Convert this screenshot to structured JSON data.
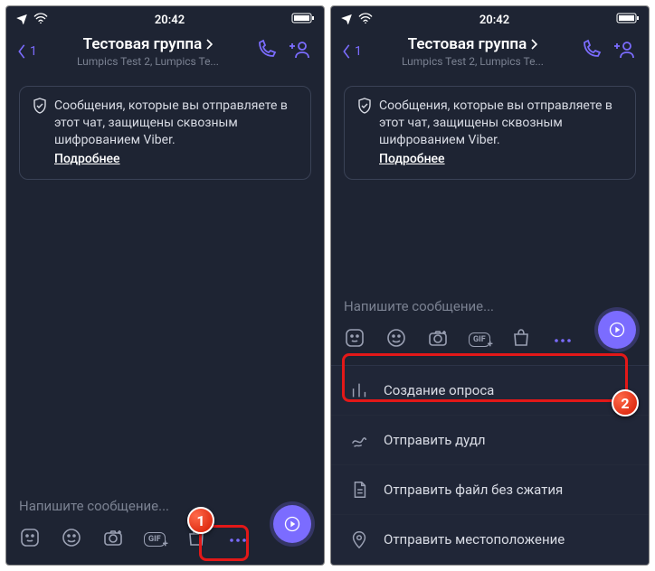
{
  "status": {
    "time": "20:42"
  },
  "nav": {
    "back_count": "1",
    "title": "Тестовая группа",
    "subtitle": "Lumpics Test 2, Lumpics Te..."
  },
  "notice": {
    "text": "Сообщения, которые вы отправляете в этот чат, защищены сквозным шифрованием Viber.",
    "more": "Подробнее"
  },
  "input": {
    "placeholder": "Напишите сообщение..."
  },
  "gif_label": "GIF",
  "menu": {
    "poll": "Создание опроса",
    "doodle": "Отправить дудл",
    "file": "Отправить файл без сжатия",
    "location": "Отправить местоположение"
  },
  "badges": {
    "one": "1",
    "two": "2"
  }
}
